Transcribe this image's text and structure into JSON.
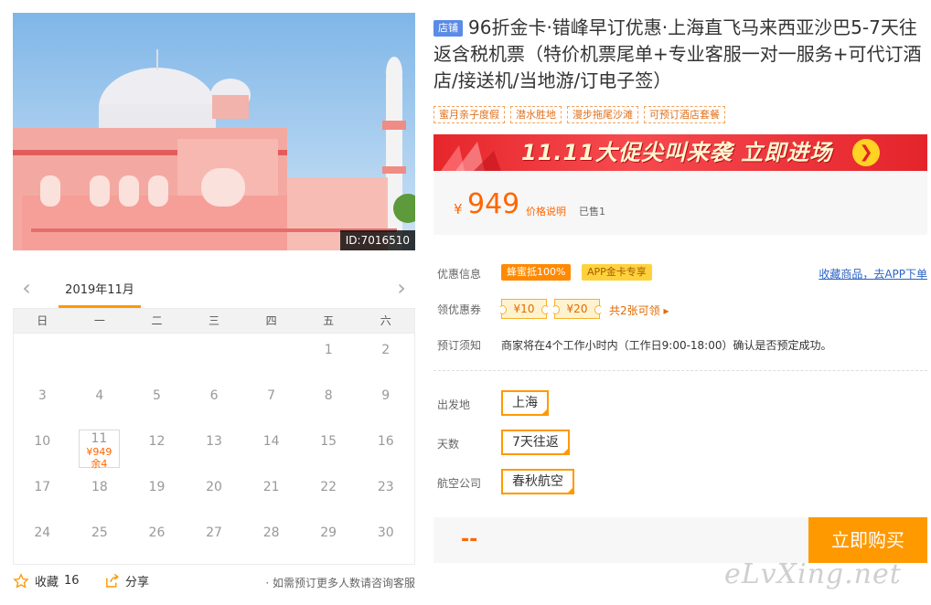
{
  "colors": {
    "accent": "#ff9900",
    "price": "#ff6600",
    "link": "#2b64c5",
    "banner": "#e6262b"
  },
  "photo": {
    "id_label": "ID:7016510"
  },
  "calendar": {
    "month_label": "2019年11月",
    "weekdays": [
      "日",
      "一",
      "二",
      "三",
      "四",
      "五",
      "六"
    ],
    "days": [
      1,
      2,
      3,
      4,
      5,
      6,
      7,
      8,
      9,
      10,
      11,
      12,
      13,
      14,
      15,
      16,
      17,
      18,
      19,
      20,
      21,
      22,
      23,
      24,
      25,
      26,
      27,
      28,
      29,
      30
    ],
    "available": {
      "day": "11",
      "price": "¥949",
      "remain": "余4"
    }
  },
  "actions": {
    "favorite_label": "收藏",
    "favorite_count": "16",
    "share_label": "分享"
  },
  "calendar_note": "· 如需预订更多人数请咨询客服",
  "product": {
    "shop_tag": "店铺",
    "title": "96折金卡·错峰早订优惠·上海直飞马来西亚沙巴5-7天往返含税机票（特价机票尾单+专业客服一对一服务+可代订酒店/接送机/当地游/订电子签）",
    "tags": [
      "蜜月亲子度假",
      "潜水胜地",
      "漫步拖尾沙滩",
      "可预订酒店套餐"
    ]
  },
  "banner": {
    "text": "11.11大促尖叫来袭  立即进场"
  },
  "price": {
    "currency": "¥",
    "amount": "949",
    "explain": "价格说明",
    "sold": "已售1"
  },
  "offers": {
    "label": "优惠信息",
    "tags": [
      "蜂蜜抵100%",
      "APP金卡专享"
    ],
    "app_link": "收藏商品，去APP下单"
  },
  "coupons": {
    "label": "领优惠券",
    "items": [
      "¥10",
      "¥20"
    ],
    "more": "共2张可领 ▸"
  },
  "booking": {
    "label": "预订须知",
    "text": "商家将在4个工作小时内（工作日9:00-18:00）确认是否预定成功。"
  },
  "options": {
    "departure": {
      "label": "出发地",
      "value": "上海"
    },
    "days": {
      "label": "天数",
      "value": "7天往返"
    },
    "airline": {
      "label": "航空公司",
      "value": "春秋航空"
    }
  },
  "buy": {
    "total": "--",
    "button": "立即购买"
  },
  "watermark": "eLvXing.net"
}
